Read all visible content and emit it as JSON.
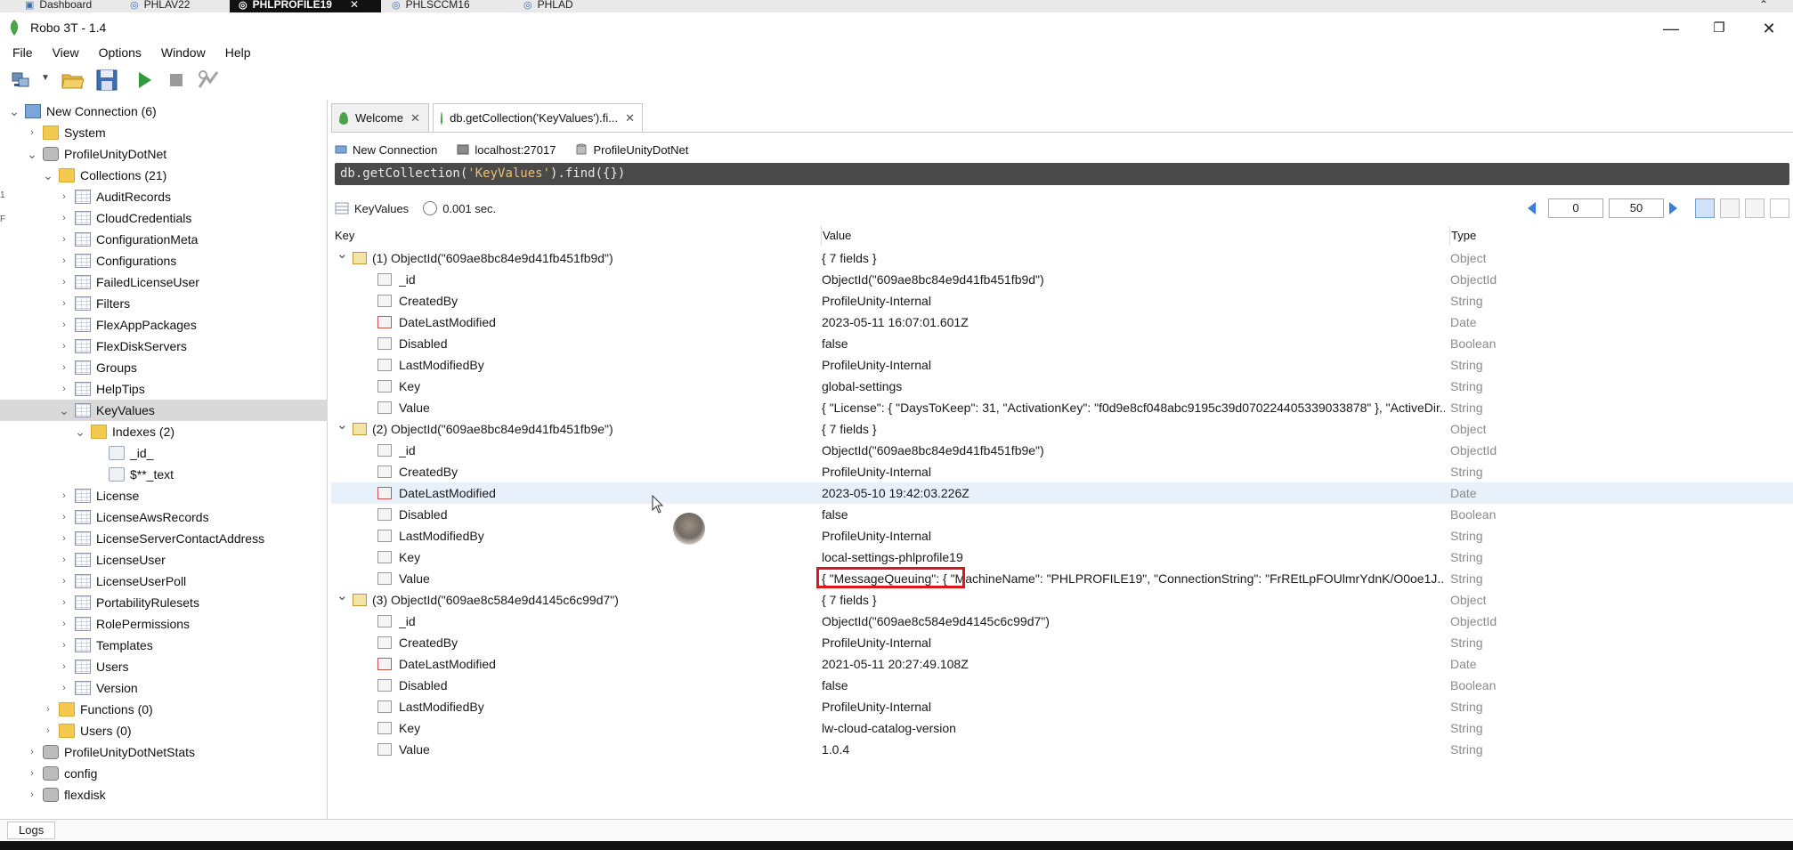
{
  "remote_tabs": [
    {
      "label": "Dashboard",
      "active": false
    },
    {
      "label": "PHLAV22",
      "active": false
    },
    {
      "label": "PHLPROFILE19",
      "active": true
    },
    {
      "label": "PHLSCCM16",
      "active": false
    },
    {
      "label": "PHLAD",
      "active": false
    }
  ],
  "window": {
    "title": "Robo 3T - 1.4"
  },
  "menu": [
    "File",
    "View",
    "Options",
    "Window",
    "Help"
  ],
  "tree": [
    {
      "label": "New Connection (6)",
      "level": 0,
      "icon": "server",
      "expanded": true
    },
    {
      "label": "System",
      "level": 1,
      "icon": "folder",
      "expanded": false
    },
    {
      "label": "ProfileUnityDotNet",
      "level": 1,
      "icon": "db",
      "expanded": true
    },
    {
      "label": "Collections (21)",
      "level": 2,
      "icon": "folder",
      "expanded": true
    },
    {
      "label": "AuditRecords",
      "level": 3,
      "icon": "table"
    },
    {
      "label": "CloudCredentials",
      "level": 3,
      "icon": "table"
    },
    {
      "label": "ConfigurationMeta",
      "level": 3,
      "icon": "table"
    },
    {
      "label": "Configurations",
      "level": 3,
      "icon": "table"
    },
    {
      "label": "FailedLicenseUser",
      "level": 3,
      "icon": "table"
    },
    {
      "label": "Filters",
      "level": 3,
      "icon": "table"
    },
    {
      "label": "FlexAppPackages",
      "level": 3,
      "icon": "table"
    },
    {
      "label": "FlexDiskServers",
      "level": 3,
      "icon": "table"
    },
    {
      "label": "Groups",
      "level": 3,
      "icon": "table"
    },
    {
      "label": "HelpTips",
      "level": 3,
      "icon": "table"
    },
    {
      "label": "KeyValues",
      "level": 3,
      "icon": "table",
      "expanded": true,
      "selected": true
    },
    {
      "label": "Indexes (2)",
      "level": 4,
      "icon": "folder",
      "expanded": true
    },
    {
      "label": "_id_",
      "level": 5,
      "icon": "index",
      "leaf": true
    },
    {
      "label": "$**_text",
      "level": 5,
      "icon": "index",
      "leaf": true
    },
    {
      "label": "License",
      "level": 3,
      "icon": "table"
    },
    {
      "label": "LicenseAwsRecords",
      "level": 3,
      "icon": "table"
    },
    {
      "label": "LicenseServerContactAddress",
      "level": 3,
      "icon": "table"
    },
    {
      "label": "LicenseUser",
      "level": 3,
      "icon": "table"
    },
    {
      "label": "LicenseUserPoll",
      "level": 3,
      "icon": "table"
    },
    {
      "label": "PortabilityRulesets",
      "level": 3,
      "icon": "table"
    },
    {
      "label": "RolePermissions",
      "level": 3,
      "icon": "table"
    },
    {
      "label": "Templates",
      "level": 3,
      "icon": "table"
    },
    {
      "label": "Users",
      "level": 3,
      "icon": "table"
    },
    {
      "label": "Version",
      "level": 3,
      "icon": "table"
    },
    {
      "label": "Functions (0)",
      "level": 2,
      "icon": "folder"
    },
    {
      "label": "Users (0)",
      "level": 2,
      "icon": "folder"
    },
    {
      "label": "ProfileUnityDotNetStats",
      "level": 1,
      "icon": "db"
    },
    {
      "label": "config",
      "level": 1,
      "icon": "db"
    },
    {
      "label": "flexdisk",
      "level": 1,
      "icon": "db"
    }
  ],
  "tabs": [
    {
      "label": "Welcome",
      "active": false
    },
    {
      "label": "db.getCollection('KeyValues').fi...",
      "active": true
    }
  ],
  "connection": {
    "name": "New Connection",
    "host": "localhost:27017",
    "database": "ProfileUnityDotNet"
  },
  "query": {
    "prefix": "db.getCollection(",
    "string": "'KeyValues'",
    "suffix": ").find({})"
  },
  "result": {
    "collection": "KeyValues",
    "time": "0.001 sec."
  },
  "pager": {
    "skip": "0",
    "limit": "50"
  },
  "columns": [
    "Key",
    "Value",
    "Type"
  ],
  "rows": [
    {
      "key": "(1) ObjectId(\"609ae8bc84e9d41fb451fb9d\")",
      "value": "{ 7 fields }",
      "type": "Object",
      "kind": "doc"
    },
    {
      "key": "_id",
      "value": "ObjectId(\"609ae8bc84e9d41fb451fb9d\")",
      "type": "ObjectId",
      "kind": "field"
    },
    {
      "key": "CreatedBy",
      "value": "ProfileUnity-Internal",
      "type": "String",
      "kind": "field"
    },
    {
      "key": "DateLastModified",
      "value": "2023-05-11 16:07:01.601Z",
      "type": "Date",
      "kind": "date"
    },
    {
      "key": "Disabled",
      "value": "false",
      "type": "Boolean",
      "kind": "field"
    },
    {
      "key": "LastModifiedBy",
      "value": "ProfileUnity-Internal",
      "type": "String",
      "kind": "field"
    },
    {
      "key": "Key",
      "value": "global-settings",
      "type": "String",
      "kind": "field"
    },
    {
      "key": "Value",
      "value": "{ \"License\": { \"DaysToKeep\": 31, \"ActivationKey\": \"f0d9e8cf048abc9195c39d070224405339033878\" }, \"ActiveDir...",
      "type": "String",
      "kind": "field"
    },
    {
      "key": "(2) ObjectId(\"609ae8bc84e9d41fb451fb9e\")",
      "value": "{ 7 fields }",
      "type": "Object",
      "kind": "doc"
    },
    {
      "key": "_id",
      "value": "ObjectId(\"609ae8bc84e9d41fb451fb9e\")",
      "type": "ObjectId",
      "kind": "field"
    },
    {
      "key": "CreatedBy",
      "value": "ProfileUnity-Internal",
      "type": "String",
      "kind": "field"
    },
    {
      "key": "DateLastModified",
      "value": "2023-05-10 19:42:03.226Z",
      "type": "Date",
      "kind": "date",
      "highlight": true
    },
    {
      "key": "Disabled",
      "value": "false",
      "type": "Boolean",
      "kind": "field"
    },
    {
      "key": "LastModifiedBy",
      "value": "ProfileUnity-Internal",
      "type": "String",
      "kind": "field"
    },
    {
      "key": "Key",
      "value": "local-settings-phlprofile19",
      "type": "String",
      "kind": "field"
    },
    {
      "key": "Value",
      "value": "{ \"MessageQueuing\": { \"MachineName\": \"PHLPROFILE19\", \"ConnectionString\": \"FrREtLpFOUlmrYdnK/O0oe1J...",
      "type": "String",
      "kind": "field"
    },
    {
      "key": "(3) ObjectId(\"609ae8c584e9d4145c6c99d7\")",
      "value": "{ 7 fields }",
      "type": "Object",
      "kind": "doc"
    },
    {
      "key": "_id",
      "value": "ObjectId(\"609ae8c584e9d4145c6c99d7\")",
      "type": "ObjectId",
      "kind": "field"
    },
    {
      "key": "CreatedBy",
      "value": "ProfileUnity-Internal",
      "type": "String",
      "kind": "field"
    },
    {
      "key": "DateLastModified",
      "value": "2021-05-11 20:27:49.108Z",
      "type": "Date",
      "kind": "date"
    },
    {
      "key": "Disabled",
      "value": "false",
      "type": "Boolean",
      "kind": "field"
    },
    {
      "key": "LastModifiedBy",
      "value": "ProfileUnity-Internal",
      "type": "String",
      "kind": "field"
    },
    {
      "key": "Key",
      "value": "lw-cloud-catalog-version",
      "type": "String",
      "kind": "field"
    },
    {
      "key": "Value",
      "value": "1.0.4",
      "type": "String",
      "kind": "field"
    }
  ],
  "bottom": {
    "logs_label": "Logs"
  },
  "colors": {
    "query_bg": "#4a4a4a",
    "highlight_box": "#e01515",
    "selected_row": "#d9d9d9",
    "accent": "#3c7dd6"
  }
}
